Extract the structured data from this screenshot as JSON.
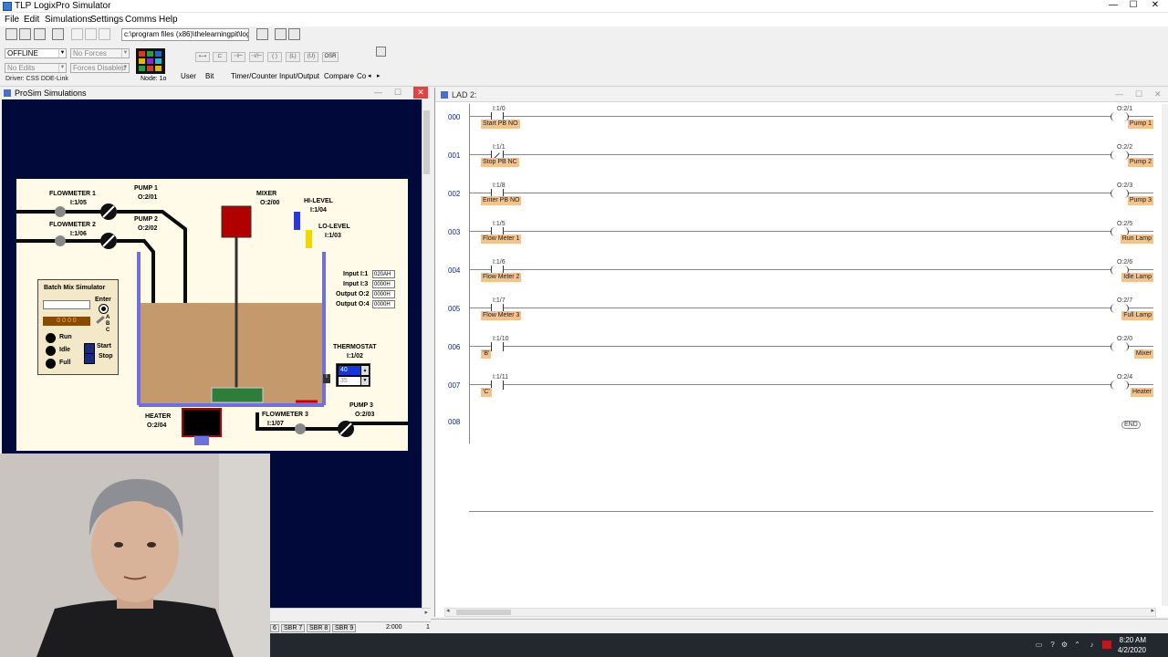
{
  "app": {
    "title": "TLP LogixPro Simulator"
  },
  "window_buttons": {
    "minimize": "—",
    "maximize": "☐",
    "close": "✕"
  },
  "menu": [
    "File",
    "Edit",
    "Simulations",
    "Settings",
    "Comms",
    "Help"
  ],
  "toolbar": {
    "path": "c:\\program files (x86)\\thelearningpit\\logixpr"
  },
  "status": {
    "mode": "OFFLINE",
    "forces": "No Forces",
    "edits": "No Edits",
    "forces_state": "Forces Disabled",
    "driver": "Driver: CSS DDE-Link",
    "node": "Node: 1o"
  },
  "instruction_tabs": [
    "User",
    "Bit",
    "Timer/Counter",
    "Input/Output",
    "Compare",
    "Co"
  ],
  "instruction_buttons": [
    "OSR"
  ],
  "prosim": {
    "title": "ProSim Simulations",
    "labels": {
      "flowmeter1": "FLOWMETER 1",
      "flowmeter1_addr": "I:1/05",
      "flowmeter2": "FLOWMETER 2",
      "flowmeter2_addr": "I:1/06",
      "pump1": "PUMP 1",
      "pump1_addr": "O:2/01",
      "pump2": "PUMP 2",
      "pump2_addr": "O:2/02",
      "mixer": "MIXER",
      "mixer_addr": "O:2/00",
      "hilevel": "HI-LEVEL",
      "hilevel_addr": "I:1/04",
      "lolevel": "LO-LEVEL",
      "lolevel_addr": "I:1/03",
      "thermostat": "THERMOSTAT",
      "thermostat_addr": "I:1/02",
      "heater": "HEATER",
      "heater_addr": "O:2/04",
      "flowmeter3": "FLOWMETER 3",
      "flowmeter3_addr": "I:1/07",
      "pump3": "PUMP 3",
      "pump3_addr": "O:2/03"
    },
    "batch": {
      "title": "Batch Mix Simulator",
      "enter": "Enter",
      "counter": "0 0 0 0",
      "lamps": [
        "Run",
        "Idle",
        "Full"
      ],
      "abc": [
        "A",
        "B",
        "C"
      ],
      "start": "Start",
      "stop": "Stop"
    },
    "io": [
      {
        "label": "Input I:1",
        "value": "020AH"
      },
      {
        "label": "Input I:3",
        "value": "0000H"
      },
      {
        "label": "Output O:2",
        "value": "0000H"
      },
      {
        "label": "Output O:4",
        "value": "0000H"
      }
    ],
    "thermostat_set": "40",
    "thermostat_actual": "35",
    "bottom_tabs": [
      "6",
      "SBR 7",
      "SBR 8",
      "SBR 9"
    ],
    "bottom_status": "2:000",
    "bottom_status2": "1"
  },
  "lad": {
    "title": "LAD 2:",
    "rungs": [
      {
        "num": "000",
        "in_addr": "I:1/0",
        "in_label": "Start PB NO",
        "nc": false,
        "out_addr": "O:2/1",
        "out_label": "Pump 1"
      },
      {
        "num": "001",
        "in_addr": "I:1/1",
        "in_label": "Stop PB NC",
        "nc": true,
        "out_addr": "O:2/2",
        "out_label": "Pump 2"
      },
      {
        "num": "002",
        "in_addr": "I:1/8",
        "in_label": "Enter PB NO",
        "nc": false,
        "out_addr": "O:2/3",
        "out_label": "Pump 3"
      },
      {
        "num": "003",
        "in_addr": "I:1/5",
        "in_label": "Flow Meter 1",
        "nc": false,
        "out_addr": "O:2/5",
        "out_label": "Run Lamp"
      },
      {
        "num": "004",
        "in_addr": "I:1/6",
        "in_label": "Flow Meter 2",
        "nc": false,
        "out_addr": "O:2/6",
        "out_label": "Idle Lamp"
      },
      {
        "num": "005",
        "in_addr": "I:1/7",
        "in_label": "Flow Meter 3",
        "nc": false,
        "out_addr": "O:2/7",
        "out_label": "Full Lamp"
      },
      {
        "num": "006",
        "in_addr": "I:1/10",
        "in_label": "'B'",
        "nc": false,
        "out_addr": "O:2/0",
        "out_label": "Mixer"
      },
      {
        "num": "007",
        "in_addr": "I:1/11",
        "in_label": "'C'",
        "nc": false,
        "out_addr": "O:2/4",
        "out_label": "Heater"
      }
    ],
    "end_rung_num": "008",
    "end_label": "END"
  },
  "taskbar": {
    "time": "8:20 AM",
    "date": "4/2/2020"
  }
}
